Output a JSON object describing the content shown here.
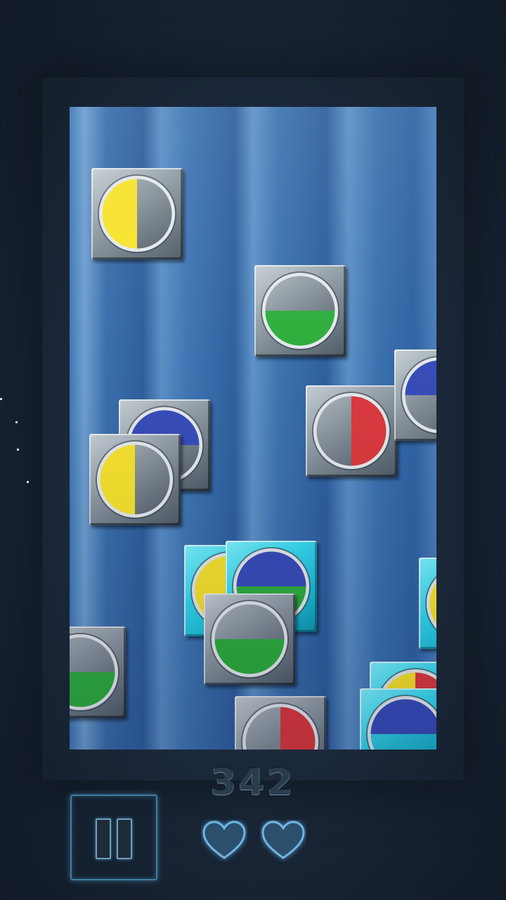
{
  "score": "342",
  "lives": 2,
  "icons": {
    "pause": "pause-icon",
    "life": "heart-icon"
  },
  "colors": {
    "yellow": "#f6e010",
    "green": "#12a323",
    "blue": "#1d35b0",
    "red": "#d61f24",
    "tile_gray": "#8e9aa3",
    "tile_cyan": "#33d8ee",
    "board_blue": "#3f76b3",
    "score_text": "#2b3c4c",
    "button_glow": "#3f7da0"
  },
  "board": {
    "tiles": [
      {
        "style": "gray",
        "segments": [
          "yellow-left"
        ]
      },
      {
        "style": "gray",
        "segments": [
          "green-bottom"
        ]
      },
      {
        "style": "gray",
        "segments": [
          "blue-top"
        ]
      },
      {
        "style": "gray",
        "segments": [
          "red-right"
        ]
      },
      {
        "style": "gray",
        "segments": [
          "blue-top"
        ]
      },
      {
        "style": "gray",
        "segments": [
          "yellow-left"
        ]
      },
      {
        "style": "cyan",
        "segments": [
          "yellow-left"
        ]
      },
      {
        "style": "cyan",
        "segments": [
          "blue-top",
          "green-bottom"
        ]
      },
      {
        "style": "cyan",
        "segments": [
          "yellow-left"
        ]
      },
      {
        "style": "gray",
        "segments": [
          "green-bottom"
        ]
      },
      {
        "style": "gray",
        "segments": [
          "green-bottom"
        ]
      },
      {
        "style": "cyan",
        "segments": [
          "yellow-left",
          "red-right"
        ]
      },
      {
        "style": "gray",
        "segments": [
          "red-right"
        ]
      },
      {
        "style": "cyan",
        "segments": [
          "blue-top"
        ]
      }
    ]
  }
}
